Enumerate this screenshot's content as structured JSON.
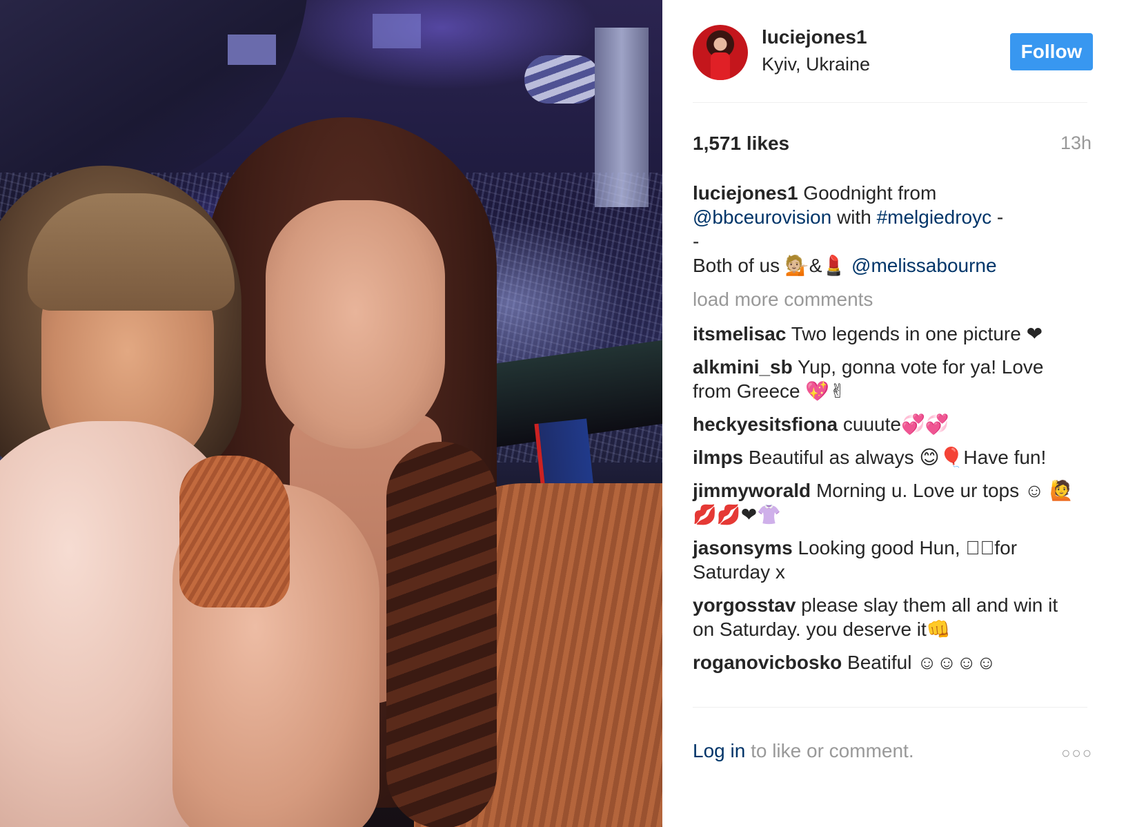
{
  "post": {
    "photo_alt": "selfie photo"
  },
  "header": {
    "username": "luciejones1",
    "location": "Kyiv, Ukraine",
    "follow_label": "Follow",
    "avatar_icon": "profile-avatar"
  },
  "stats": {
    "likes": "1,571 likes",
    "time": "13h"
  },
  "caption": {
    "user": "luciejones1",
    "text1": " Goodnight from",
    "mention1": "@bbceurovision",
    "text2": " with ",
    "hashtag": "#melgiedroyc",
    "text3": " -",
    "text4": "-",
    "text5": "Both of us 💁🏼&💄 ",
    "mention2": "@melissabourne"
  },
  "load_more": "load more comments",
  "comments": [
    {
      "user": "itsmelisac",
      "text": " Two legends in one picture ❤"
    },
    {
      "user": "alkmini_sb",
      "text": " Yup, gonna vote for ya! Love from Greece 💖✌"
    },
    {
      "user": "heckyesitsfiona",
      "text": " cuuute💞💞"
    },
    {
      "user": "ilmps",
      "text": " Beautiful as always 😊🎈Have fun!"
    },
    {
      "user": "jimmyworald",
      "text": " Morning u. Love ur tops ☺ 🙋💋💋❤👚"
    },
    {
      "user": "jasonsyms",
      "text": " Looking good Hun, ☐🏼for Saturday x"
    },
    {
      "user": "yorgosstav",
      "text": " please slay them all and win it on Saturday. you deserve it👊"
    },
    {
      "user": "roganovicbosko",
      "text": " Beatiful ☺☺☺☺"
    }
  ],
  "footer": {
    "login_link": "Log in",
    "login_text": " to like or comment.",
    "more_icon": "more-options-icon",
    "more_glyph": "○○○"
  }
}
